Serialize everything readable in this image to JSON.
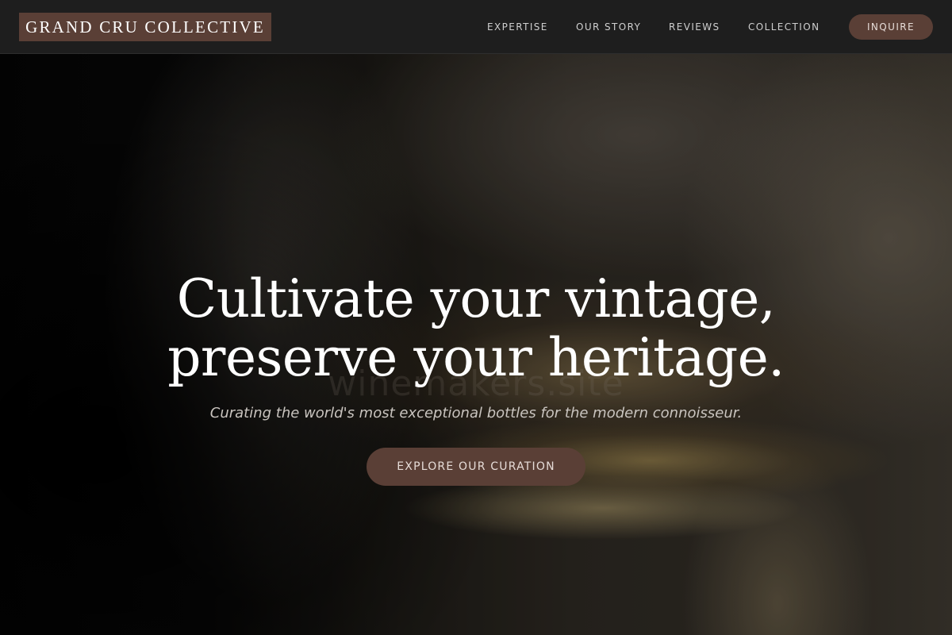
{
  "brand": {
    "name": "GRAND CRU COLLECTIVE",
    "accent_color": "#5a3f36"
  },
  "nav": {
    "items": [
      {
        "label": "EXPERTISE"
      },
      {
        "label": "OUR STORY"
      },
      {
        "label": "REVIEWS"
      },
      {
        "label": "COLLECTION"
      }
    ],
    "cta_label": "INQUIRE"
  },
  "hero": {
    "headline_line1": "Cultivate your vintage,",
    "headline_line2": "preserve your heritage.",
    "subtitle": "Curating the world's most exceptional bottles for the modern connoisseur.",
    "cta_label": "EXPLORE OUR CURATION",
    "background_image": "blurred-wine-glass"
  },
  "watermark": "winemakers.site"
}
